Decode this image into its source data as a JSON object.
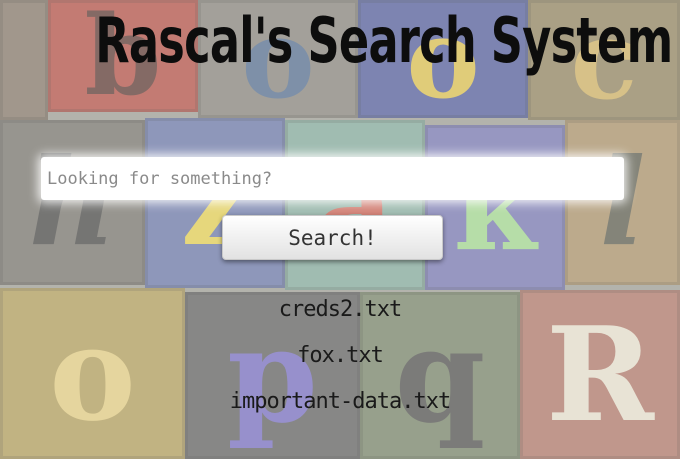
{
  "app": {
    "title": "Rascal's Search System"
  },
  "search": {
    "placeholder": "Looking for something?",
    "value": "",
    "button_label": "Search!"
  },
  "results": [
    "creds2.txt",
    "fox.txt",
    "important-data.txt"
  ],
  "background_letters": [
    "b",
    "o",
    "o",
    "c",
    "h",
    "z",
    "a",
    "k",
    "l",
    "o",
    "p",
    "q",
    "R"
  ],
  "colors": {
    "title": "#0d0d0d",
    "input_bg": "#ffffff",
    "button_bg": "#f2f2f2",
    "result_text": "#1a1a1a"
  }
}
